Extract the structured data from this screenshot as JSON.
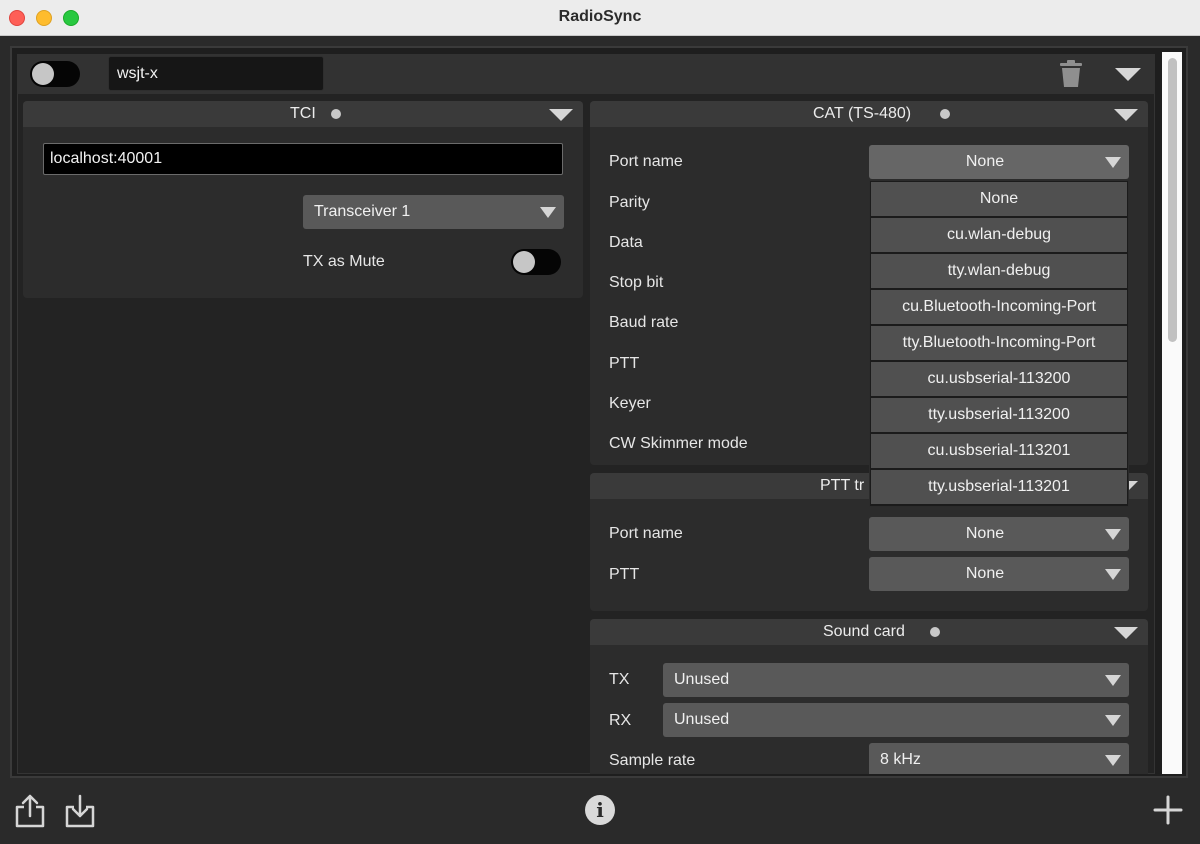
{
  "window": {
    "title": "RadioSync"
  },
  "profile": {
    "name": "wsjt-x"
  },
  "tci": {
    "title": "TCI",
    "address": "localhost:40001",
    "transceiver": "Transceiver 1",
    "tx_as_mute_label": "TX as Mute"
  },
  "cat": {
    "title": "CAT (TS-480)",
    "fields": [
      {
        "label": "Port name",
        "value": "None"
      },
      {
        "label": "Parity"
      },
      {
        "label": "Data"
      },
      {
        "label": "Stop bit"
      },
      {
        "label": "Baud rate"
      },
      {
        "label": "PTT"
      },
      {
        "label": "Keyer"
      },
      {
        "label": "CW Skimmer mode"
      }
    ],
    "port_options": [
      "None",
      "cu.wlan-debug",
      "tty.wlan-debug",
      "cu.Bluetooth-Incoming-Port",
      "tty.Bluetooth-Incoming-Port",
      "cu.usbserial-113200",
      "tty.usbserial-113200",
      "cu.usbserial-113201",
      "tty.usbserial-113201"
    ]
  },
  "ptt": {
    "title_visible": "PTT tr",
    "port_label": "Port name",
    "port_value": "None",
    "ptt_label": "PTT",
    "ptt_value": "None"
  },
  "sound": {
    "title": "Sound card",
    "tx_label": "TX",
    "tx_value": "Unused",
    "rx_label": "RX",
    "rx_value": "Unused",
    "rate_label": "Sample rate",
    "rate_value": "8 kHz"
  },
  "icons": {
    "bottom_left": [
      "share-icon",
      "download-icon"
    ],
    "center": "info-icon",
    "right": "plus-icon"
  }
}
